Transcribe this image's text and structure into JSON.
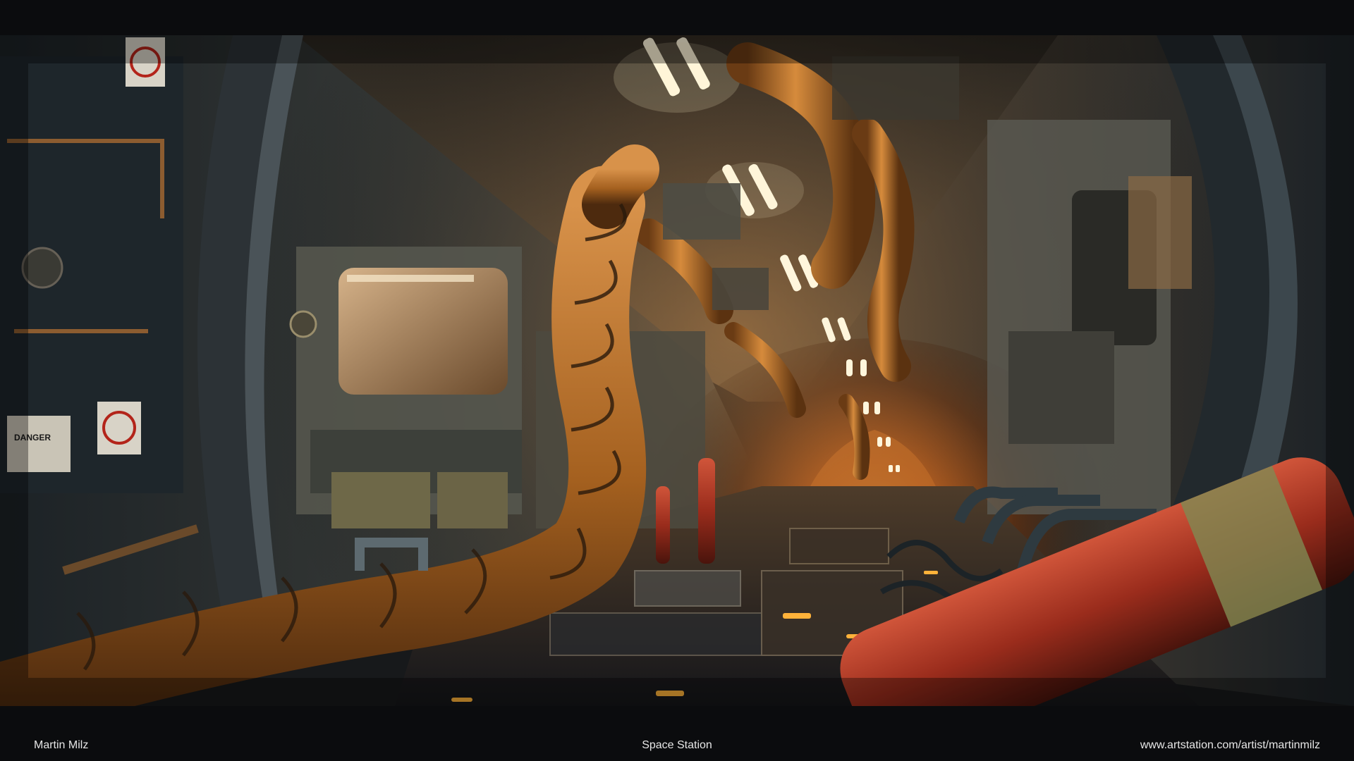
{
  "caption": {
    "author": "Martin Milz",
    "title": "Space Station",
    "url": "www.artstation.com/artist/martinmilz"
  },
  "scene": {
    "warning_sign_text": "DANGER"
  },
  "colors": {
    "background": "#0b0c0e",
    "caption_text": "#e6e6e6",
    "hot_glow": "#ff8a1e",
    "hose_amber": "#c27a2e",
    "ceiling_light": "#fff6dc",
    "wall_steel": "#3f474c",
    "extinguisher_red": "#a8321f"
  }
}
